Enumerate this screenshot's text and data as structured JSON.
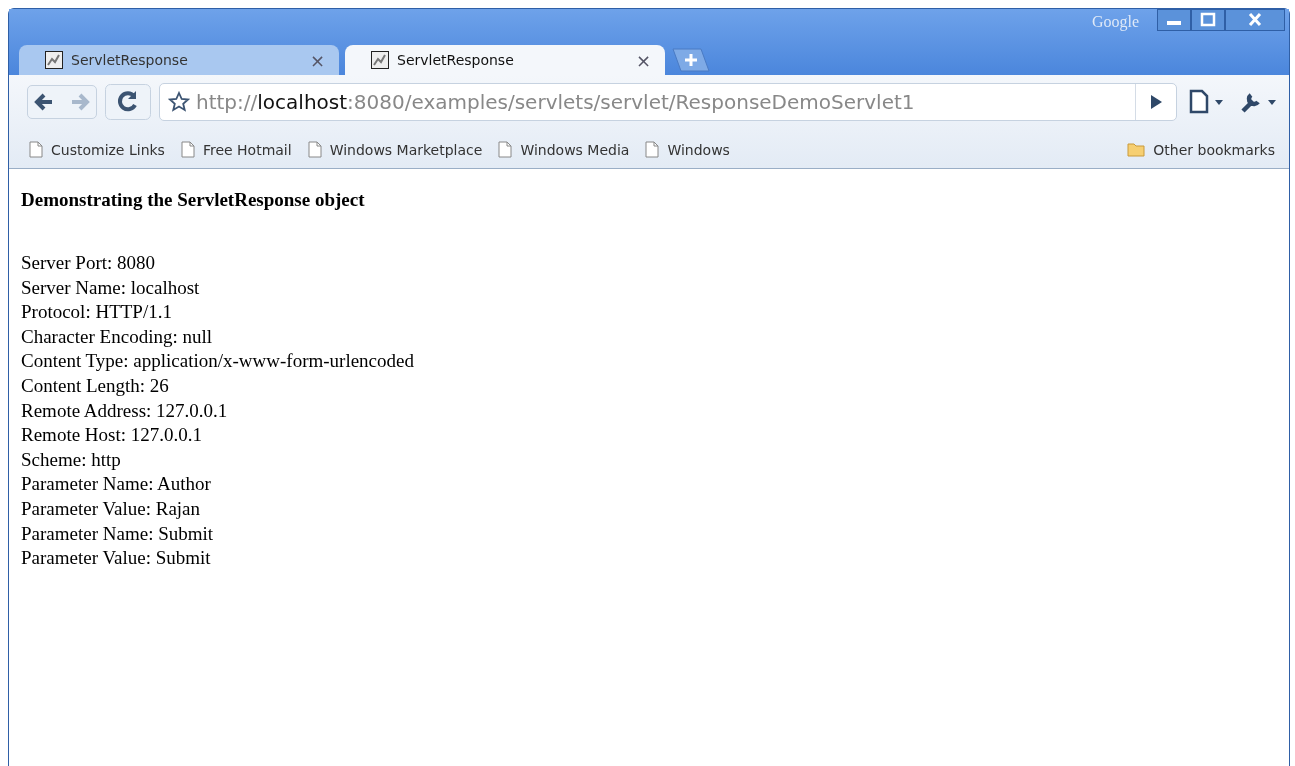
{
  "window": {
    "brand": "Google"
  },
  "tabs": [
    {
      "title": "ServletResponse",
      "selected": false,
      "close": "×"
    },
    {
      "title": "ServletResponse",
      "selected": true,
      "close": "×"
    }
  ],
  "address_bar": {
    "url": "http://**localhost**:8080/examples/servlets/servlet/ResponseDemoServlet1"
  },
  "bookmarks": [
    {
      "label": "Customize Links",
      "kind": "page"
    },
    {
      "label": "Free Hotmail",
      "kind": "page"
    },
    {
      "label": "Windows Marketplace",
      "kind": "page"
    },
    {
      "label": "Windows Media",
      "kind": "page"
    },
    {
      "label": "Windows",
      "kind": "page"
    }
  ],
  "other_bookmarks": {
    "label": "Other bookmarks",
    "kind": "folder"
  },
  "page": {
    "heading": "Demonstrating the ServletResponse object",
    "lines": [
      "Server Port: 8080",
      "Server Name: localhost",
      "Protocol: HTTP/1.1",
      "Character Encoding: null",
      "Content Type: application/x-www-form-urlencoded",
      "Content Length: 26",
      "Remote Address: 127.0.0.1",
      "Remote Host: 127.0.0.1",
      "Scheme: http",
      "Parameter Name: Author",
      "Parameter Value: Rajan",
      "Parameter Name: Submit",
      "Parameter Value: Submit"
    ]
  }
}
